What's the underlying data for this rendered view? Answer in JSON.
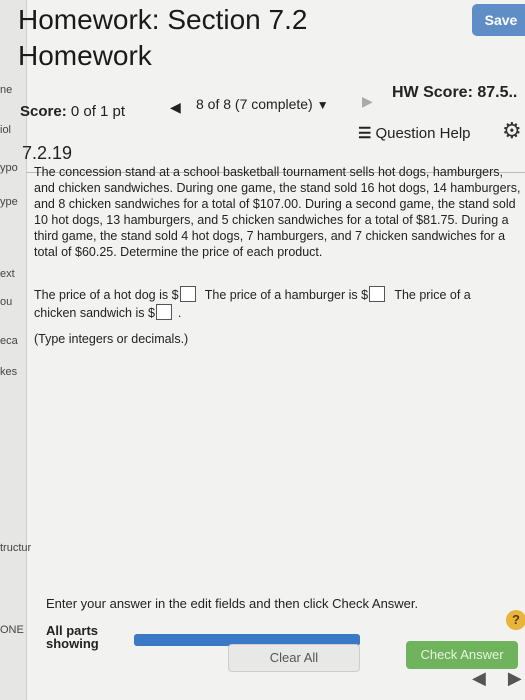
{
  "left_strip": [
    "ne",
    "iol",
    "ypo",
    "ype",
    "ext",
    "ou",
    "eca",
    "kes",
    "tructur",
    "ONE"
  ],
  "header": {
    "title_line1": "Homework: Section 7.2",
    "title_line2": "Homework",
    "save_label": "Save"
  },
  "status": {
    "score_label": "Score:",
    "score_value": "0 of 1 pt",
    "nav_prev": "◀",
    "question_position": "8 of 8 (7 complete)",
    "nav_caret": "▼",
    "nav_next": "▶",
    "hw_score": "HW Score: 87.5.."
  },
  "question": {
    "number": "7.2.19",
    "help_label": "Question Help",
    "text": "The concession stand at a school basketball tournament sells hot dogs, hamburgers, and chicken sandwiches. During one game, the stand sold 16 hot dogs, 14 hamburgers, and 8 chicken sandwiches for a total of $107.00. During a second game, the stand sold 10 hot dogs, 13 hamburgers, and 5 chicken sandwiches for a total of $81.75. During a third game, the stand sold 4 hot dogs, 7 hamburgers, and 7 chicken sandwiches for a total of $60.25. Determine the price of each product.",
    "answer1_label": "The price of a hot dog is $",
    "answer2_label": "The price of a hamburger is $",
    "answer3_label": "The price of a chicken sandwich is $",
    "answer3_end": ".",
    "hint": "(Type integers or decimals.)"
  },
  "footer": {
    "instruction": "Enter your answer in the edit fields and then click Check Answer.",
    "help_symbol": "?",
    "parts_line1": "All parts",
    "parts_line2": "showing",
    "clear_label": "Clear All",
    "check_label": "Check Answer",
    "nav_prev": "◀",
    "nav_next": "▶"
  }
}
